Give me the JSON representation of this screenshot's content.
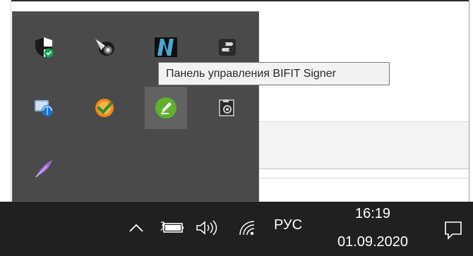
{
  "tray_popup": {
    "icons": [
      {
        "name": "windows-security-icon"
      },
      {
        "name": "speaker-app-icon"
      },
      {
        "name": "n-app-icon"
      },
      {
        "name": "toggle-app-icon"
      },
      {
        "name": "network-settings-icon"
      },
      {
        "name": "orange-checkmark-icon"
      },
      {
        "name": "bifit-signer-icon"
      },
      {
        "name": "camera-app-icon"
      },
      {
        "name": "purple-feather-icon"
      }
    ]
  },
  "tooltip": {
    "text": "Панель управления BIFIT Signer"
  },
  "taskbar": {
    "show_hidden_icon": "chevron-up-icon",
    "battery_icon": "battery-icon",
    "volume_icon": "volume-icon",
    "wifi_icon": "wifi-icon",
    "language": "РУС",
    "time": "16:19",
    "date": "01.09.2020",
    "notification_icon": "action-center-icon"
  },
  "colors": {
    "taskbar_bg": "#202020",
    "tray_bg": "#4a4a4a",
    "tooltip_bg": "#f2f2f2"
  }
}
